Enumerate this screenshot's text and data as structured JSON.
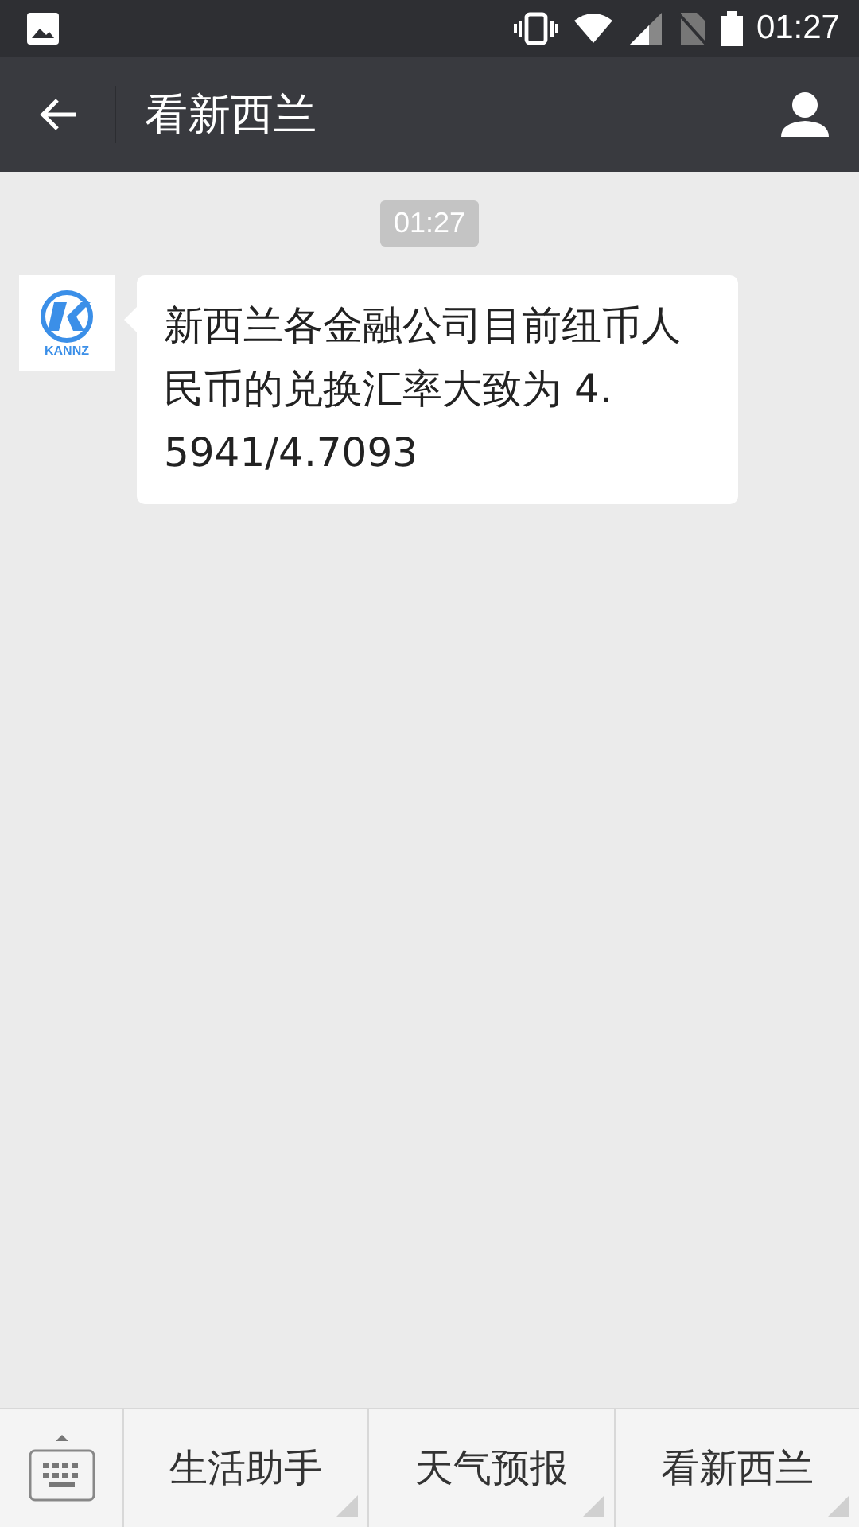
{
  "status_bar": {
    "time": "01:27"
  },
  "header": {
    "title": "看新西兰"
  },
  "messages": [
    {
      "kind": "time",
      "text": "01:27"
    },
    {
      "kind": "incoming",
      "avatar_text": "KANNZ",
      "lines": [
        "新西兰各金融公司目前纽币人",
        "民币的兑换汇率大致为 4.",
        "5941/4.7093"
      ]
    }
  ],
  "menu": [
    "生活助手",
    "天气预报",
    "看新西兰"
  ]
}
